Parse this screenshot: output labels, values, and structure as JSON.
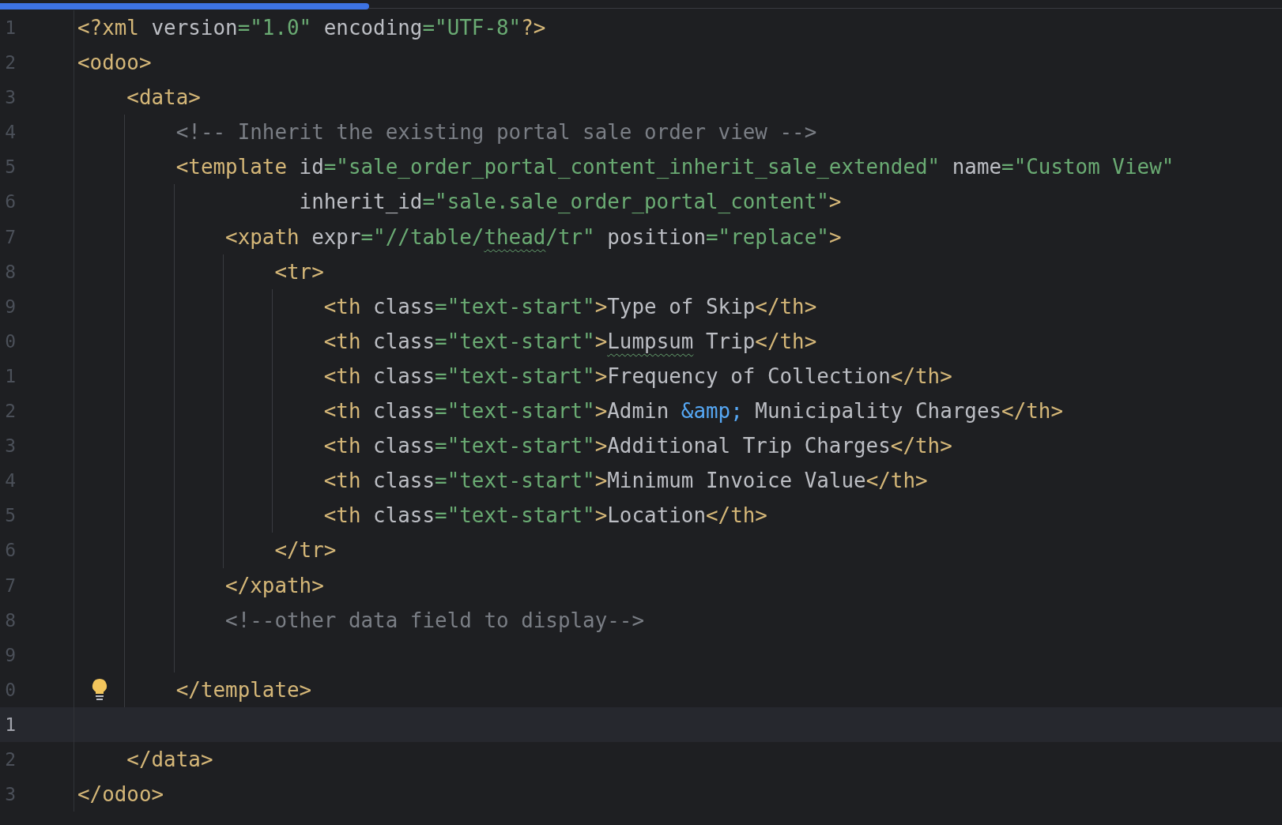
{
  "lines": [
    {
      "number": "1",
      "kind": "decl",
      "current": false,
      "hint": false,
      "tokens": [
        {
          "kind": "tag",
          "text": "<?xml"
        },
        {
          "kind": "attr",
          "text": " version"
        },
        {
          "kind": "value",
          "text": "=\"1.0\""
        },
        {
          "kind": "attr",
          "text": " encoding"
        },
        {
          "kind": "value",
          "text": "=\"UTF-8\""
        },
        {
          "kind": "tag",
          "text": "?>"
        }
      ]
    },
    {
      "number": "2",
      "kind": "open",
      "current": false,
      "hint": false,
      "tokens": [
        {
          "kind": "tag",
          "text": "<odoo>"
        }
      ]
    },
    {
      "number": "3",
      "kind": "open",
      "current": false,
      "hint": false,
      "tokens": [
        {
          "kind": "tag",
          "text": "    <data>"
        }
      ]
    },
    {
      "number": "4",
      "kind": "comment",
      "current": false,
      "hint": false,
      "tokens": [
        {
          "kind": "comment",
          "text": "        <!-- Inherit the existing portal sale order view -->"
        }
      ]
    },
    {
      "number": "5",
      "kind": "open",
      "current": false,
      "hint": false,
      "tokens": [
        {
          "kind": "tag",
          "text": "        <template"
        },
        {
          "kind": "attr",
          "text": " id"
        },
        {
          "kind": "value",
          "text": "=\"sale_order_portal_content_inherit_sale_extended\""
        },
        {
          "kind": "attr",
          "text": " name"
        },
        {
          "kind": "value",
          "text": "=\"Custom View\""
        }
      ]
    },
    {
      "number": "6",
      "kind": "attrs",
      "current": false,
      "hint": false,
      "tokens": [
        {
          "kind": "attr",
          "text": "                  inherit_id"
        },
        {
          "kind": "value",
          "text": "=\"sale.sale_order_portal_content\""
        },
        {
          "kind": "tag",
          "text": ">"
        }
      ]
    },
    {
      "number": "7",
      "kind": "open",
      "current": false,
      "hint": false,
      "tokens": [
        {
          "kind": "tag",
          "text": "            <xpath"
        },
        {
          "kind": "attr",
          "text": " expr"
        },
        {
          "kind": "value",
          "text": "=\"//table/"
        },
        {
          "kind": "misspelled-value",
          "text": "thead"
        },
        {
          "kind": "value",
          "text": "/tr\""
        },
        {
          "kind": "attr",
          "text": " position"
        },
        {
          "kind": "value",
          "text": "=\"replace\""
        },
        {
          "kind": "tag",
          "text": ">"
        }
      ]
    },
    {
      "number": "8",
      "kind": "open",
      "current": false,
      "hint": false,
      "tokens": [
        {
          "kind": "tag",
          "text": "                <tr>"
        }
      ]
    },
    {
      "number": "9",
      "kind": "single",
      "current": false,
      "hint": false,
      "tokens": [
        {
          "kind": "tag",
          "text": "                    <th"
        },
        {
          "kind": "attr",
          "text": " class"
        },
        {
          "kind": "value",
          "text": "=\"text-start\""
        },
        {
          "kind": "tag",
          "text": ">"
        },
        {
          "kind": "text",
          "text": "Type of Skip"
        },
        {
          "kind": "tag",
          "text": "</th>"
        }
      ]
    },
    {
      "number": "0",
      "kind": "single",
      "current": false,
      "hint": false,
      "tokens": [
        {
          "kind": "tag",
          "text": "                    <th"
        },
        {
          "kind": "attr",
          "text": " class"
        },
        {
          "kind": "value",
          "text": "=\"text-start\""
        },
        {
          "kind": "tag",
          "text": ">"
        },
        {
          "kind": "misspelled-text",
          "text": "Lumpsum"
        },
        {
          "kind": "text",
          "text": " Trip"
        },
        {
          "kind": "tag",
          "text": "</th>"
        }
      ]
    },
    {
      "number": "1",
      "kind": "single",
      "current": false,
      "hint": false,
      "tokens": [
        {
          "kind": "tag",
          "text": "                    <th"
        },
        {
          "kind": "attr",
          "text": " class"
        },
        {
          "kind": "value",
          "text": "=\"text-start\""
        },
        {
          "kind": "tag",
          "text": ">"
        },
        {
          "kind": "text",
          "text": "Frequency of Collection"
        },
        {
          "kind": "tag",
          "text": "</th>"
        }
      ]
    },
    {
      "number": "2",
      "kind": "single",
      "current": false,
      "hint": false,
      "tokens": [
        {
          "kind": "tag",
          "text": "                    <th"
        },
        {
          "kind": "attr",
          "text": " class"
        },
        {
          "kind": "value",
          "text": "=\"text-start\""
        },
        {
          "kind": "tag",
          "text": ">"
        },
        {
          "kind": "text",
          "text": "Admin "
        },
        {
          "kind": "entity",
          "text": "&amp;"
        },
        {
          "kind": "text",
          "text": " Municipality Charges"
        },
        {
          "kind": "tag",
          "text": "</th>"
        }
      ]
    },
    {
      "number": "3",
      "kind": "single",
      "current": false,
      "hint": false,
      "tokens": [
        {
          "kind": "tag",
          "text": "                    <th"
        },
        {
          "kind": "attr",
          "text": " class"
        },
        {
          "kind": "value",
          "text": "=\"text-start\""
        },
        {
          "kind": "tag",
          "text": ">"
        },
        {
          "kind": "text",
          "text": "Additional Trip Charges"
        },
        {
          "kind": "tag",
          "text": "</th>"
        }
      ]
    },
    {
      "number": "4",
      "kind": "single",
      "current": false,
      "hint": false,
      "tokens": [
        {
          "kind": "tag",
          "text": "                    <th"
        },
        {
          "kind": "attr",
          "text": " class"
        },
        {
          "kind": "value",
          "text": "=\"text-start\""
        },
        {
          "kind": "tag",
          "text": ">"
        },
        {
          "kind": "text",
          "text": "Minimum Invoice Value"
        },
        {
          "kind": "tag",
          "text": "</th>"
        }
      ]
    },
    {
      "number": "5",
      "kind": "single",
      "current": false,
      "hint": false,
      "tokens": [
        {
          "kind": "tag",
          "text": "                    <th"
        },
        {
          "kind": "attr",
          "text": " class"
        },
        {
          "kind": "value",
          "text": "=\"text-start\""
        },
        {
          "kind": "tag",
          "text": ">"
        },
        {
          "kind": "text",
          "text": "Location"
        },
        {
          "kind": "tag",
          "text": "</th>"
        }
      ]
    },
    {
      "number": "6",
      "kind": "close",
      "current": false,
      "hint": false,
      "tokens": [
        {
          "kind": "tag",
          "text": "                </tr>"
        }
      ]
    },
    {
      "number": "7",
      "kind": "close",
      "current": false,
      "hint": false,
      "tokens": [
        {
          "kind": "tag",
          "text": "            </xpath>"
        }
      ]
    },
    {
      "number": "8",
      "kind": "comment",
      "current": false,
      "hint": false,
      "tokens": [
        {
          "kind": "comment",
          "text": "            <!--other data field to display-->"
        }
      ]
    },
    {
      "number": "9",
      "kind": "blank",
      "current": false,
      "hint": false
    },
    {
      "number": "0",
      "kind": "close",
      "current": false,
      "hint": true,
      "tokens": [
        {
          "kind": "tag",
          "text": "        </template>"
        }
      ]
    },
    {
      "number": "1",
      "kind": "blank",
      "current": true,
      "hint": false
    },
    {
      "number": "2",
      "kind": "close",
      "current": false,
      "hint": false,
      "tokens": [
        {
          "kind": "tag",
          "text": "    </data>"
        }
      ]
    },
    {
      "number": "3",
      "kind": "close",
      "current": false,
      "hint": false,
      "tokens": [
        {
          "kind": "tag",
          "text": "</odoo>"
        }
      ]
    }
  ]
}
